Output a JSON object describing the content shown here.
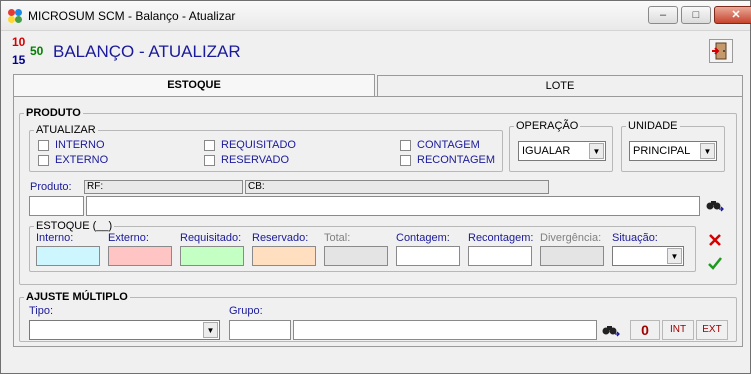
{
  "window": {
    "title": "MICROSUM SCM - Balanço - Atualizar",
    "controls": [
      "–",
      "□",
      "✕"
    ]
  },
  "header": {
    "logo": {
      "n1": "10",
      "n2": "50",
      "n3": "15"
    },
    "title": "BALANÇO - ATUALIZAR"
  },
  "tabs": [
    {
      "label": "ESTOQUE",
      "active": true
    },
    {
      "label": "LOTE",
      "active": false
    }
  ],
  "produto": {
    "legend": "PRODUTO",
    "atualizar": {
      "legend": "ATUALIZAR",
      "options": [
        "INTERNO",
        "EXTERNO",
        "REQUISITADO",
        "RESERVADO",
        "CONTAGEM",
        "RECONTAGEM"
      ]
    },
    "operacao": {
      "legend": "OPERAÇÃO",
      "value": "IGUALAR"
    },
    "unidade": {
      "legend": "UNIDADE",
      "value": "PRINCIPAL"
    },
    "produto_label": "Produto:",
    "rf_label": "RF:",
    "cb_label": "CB:"
  },
  "estoque": {
    "legend": "ESTOQUE (__)",
    "columns": [
      "Interno:",
      "Externo:",
      "Requisitado:",
      "Reservado:",
      "Total:",
      "Contagem:",
      "Recontagem:",
      "Divergência:",
      "Situação:"
    ],
    "colors": {
      "interno": "#cdf6ff",
      "externo": "#ffc4c4",
      "requisitado": "#c4ffc4",
      "reservado": "#ffdfbf",
      "disabled": "#e4e4e4"
    }
  },
  "ajuste": {
    "legend": "AJUSTE MÚLTIPLO",
    "tipo_label": "Tipo:",
    "grupo_label": "Grupo:",
    "buttons": [
      "0",
      "INT",
      "EXT"
    ]
  },
  "icons": {
    "search": "binoculars-icon",
    "cancel": "x-icon",
    "confirm": "check-icon",
    "exit": "exit-door-icon"
  }
}
